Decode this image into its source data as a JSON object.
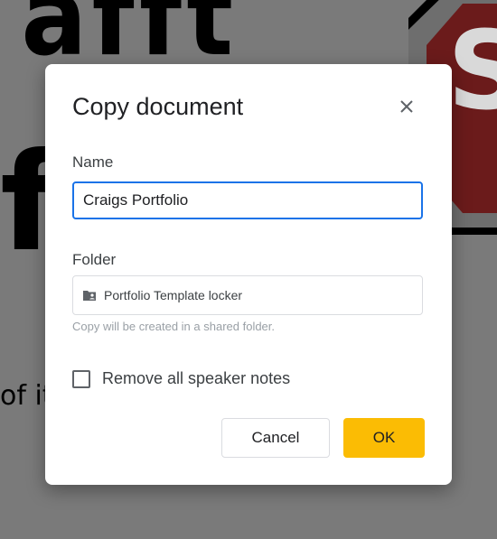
{
  "dialog": {
    "title": "Copy document",
    "name_label": "Name",
    "name_value": "Craigs Portfolio",
    "folder_label": "Folder",
    "folder_name": "Portfolio Template locker",
    "folder_hint": "Copy will be created in a shared folder.",
    "checkbox_label": "Remove all speaker notes",
    "checkbox_checked": false,
    "cancel_label": "Cancel",
    "ok_label": "OK",
    "accent_color": "#1a73e8",
    "ok_color": "#fbbc04"
  },
  "background": {
    "text_top": "afft",
    "text_mid": "fe",
    "text_low": "of it",
    "stop_letter": "S"
  },
  "icons": {
    "close": "close-icon",
    "folder": "shared-folder-icon"
  }
}
